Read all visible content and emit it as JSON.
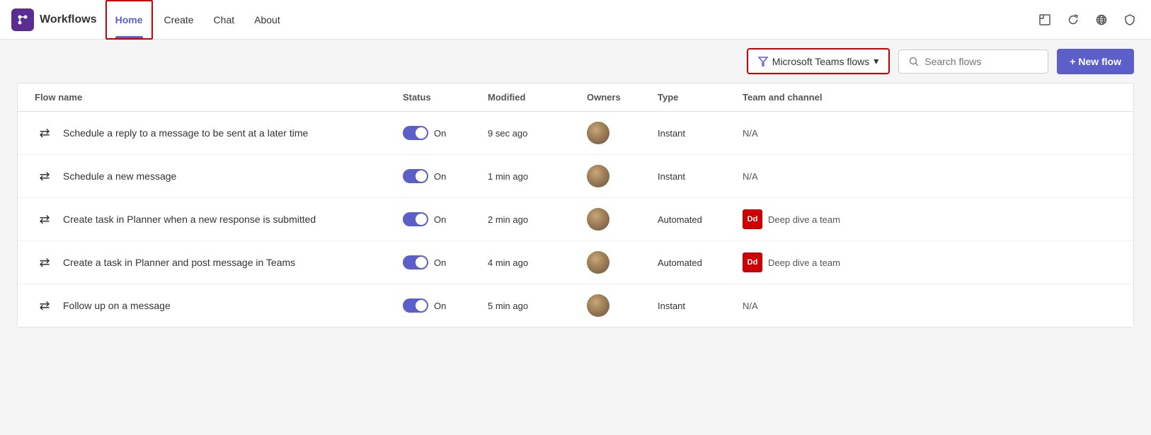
{
  "app": {
    "logo_label": "Workflows",
    "nav_items": [
      {
        "id": "home",
        "label": "Home",
        "active": true
      },
      {
        "id": "create",
        "label": "Create",
        "active": false
      },
      {
        "id": "chat",
        "label": "Chat",
        "active": false
      },
      {
        "id": "about",
        "label": "About",
        "active": false
      }
    ],
    "right_icons": [
      "popup-icon",
      "refresh-icon",
      "globe-icon",
      "shield-icon"
    ]
  },
  "toolbar": {
    "filter_label": "Microsoft Teams flows",
    "filter_dropdown_icon": "▾",
    "search_placeholder": "Search flows",
    "new_flow_label": "+ New flow"
  },
  "table": {
    "headers": [
      {
        "id": "flow-name",
        "label": "Flow name"
      },
      {
        "id": "status",
        "label": "Status"
      },
      {
        "id": "modified",
        "label": "Modified"
      },
      {
        "id": "owners",
        "label": "Owners"
      },
      {
        "id": "type",
        "label": "Type"
      },
      {
        "id": "team-channel",
        "label": "Team and channel"
      }
    ],
    "rows": [
      {
        "id": 1,
        "name": "Schedule a reply to a message to be sent at a later time",
        "status": "On",
        "modified": "9 sec ago",
        "type": "Instant",
        "team": "N/A",
        "team_badge": null
      },
      {
        "id": 2,
        "name": "Schedule a new message",
        "status": "On",
        "modified": "1 min ago",
        "type": "Instant",
        "team": "N/A",
        "team_badge": null
      },
      {
        "id": 3,
        "name": "Create task in Planner when a new response is submitted",
        "status": "On",
        "modified": "2 min ago",
        "type": "Automated",
        "team": "Deep dive a team",
        "team_badge": "Dd",
        "team_badge_color": "#c00"
      },
      {
        "id": 4,
        "name": "Create a task in Planner and post message in Teams",
        "status": "On",
        "modified": "4 min ago",
        "type": "Automated",
        "team": "Deep dive a team",
        "team_badge": "Dd",
        "team_badge_color": "#c00"
      },
      {
        "id": 5,
        "name": "Follow up on a message",
        "status": "On",
        "modified": "5 min ago",
        "type": "Instant",
        "team": "N/A",
        "team_badge": null
      }
    ]
  }
}
